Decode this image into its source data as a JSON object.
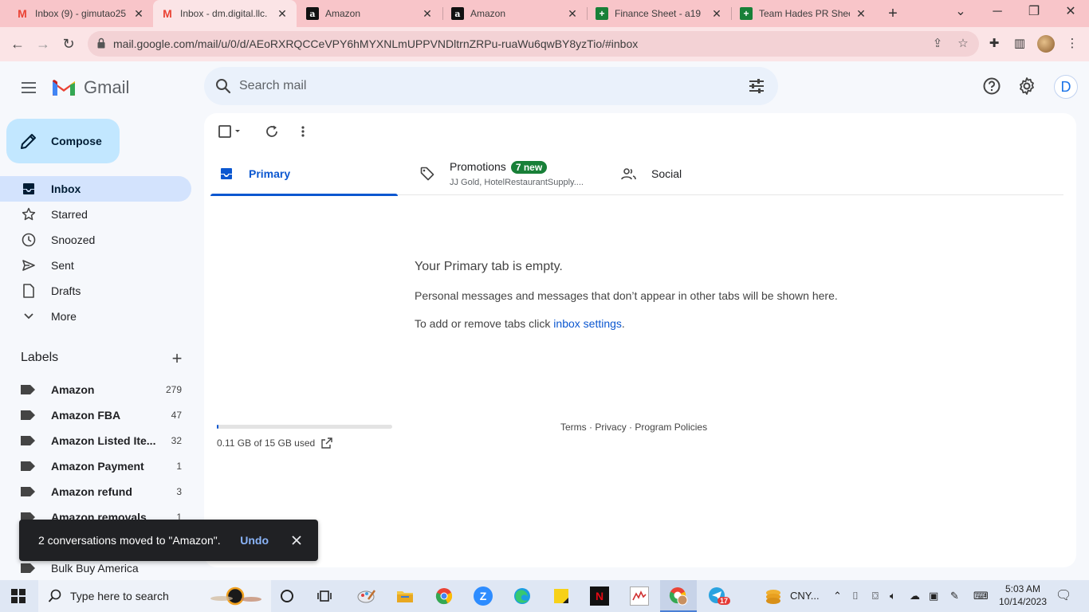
{
  "browser": {
    "tabs": [
      {
        "title": "Inbox (9) - gimutao25",
        "favicon": "gmail-icon"
      },
      {
        "title": "Inbox - dm.digital.llc.",
        "favicon": "gmail-icon",
        "active": true
      },
      {
        "title": "Amazon",
        "favicon": "amazon-icon"
      },
      {
        "title": "Amazon",
        "favicon": "amazon-icon"
      },
      {
        "title": "Finance Sheet - a19",
        "favicon": "sheets-icon"
      },
      {
        "title": "Team Hades PR Shee",
        "favicon": "sheets-icon"
      }
    ],
    "url": "mail.google.com/mail/u/0/d/AEoRXRQCCeVPY6hMYXNLmUPPVNDltrnZRPu-ruaWu6qwBY8yzTio/#inbox"
  },
  "gmail": {
    "product_name": "Gmail",
    "search_placeholder": "Search mail",
    "avatar_letter": "D",
    "compose_label": "Compose",
    "nav": [
      {
        "label": "Inbox",
        "icon": "inbox-icon",
        "active": true
      },
      {
        "label": "Starred",
        "icon": "star-icon"
      },
      {
        "label": "Snoozed",
        "icon": "clock-icon"
      },
      {
        "label": "Sent",
        "icon": "send-icon"
      },
      {
        "label": "Drafts",
        "icon": "draft-icon"
      },
      {
        "label": "More",
        "icon": "chevron-down-icon"
      }
    ],
    "labels_title": "Labels",
    "labels": [
      {
        "name": "Amazon",
        "count": "279"
      },
      {
        "name": "Amazon FBA",
        "count": "47"
      },
      {
        "name": "Amazon Listed Ite...",
        "count": "32"
      },
      {
        "name": "Amazon Payment",
        "count": "1"
      },
      {
        "name": "Amazon refund",
        "count": "3"
      },
      {
        "name": "Amazon removals",
        "count": "1"
      },
      {
        "name": "Bulk Buy America",
        "count": ""
      }
    ],
    "tabs": [
      {
        "name": "Primary",
        "icon": "inbox-tab-icon",
        "active": true
      },
      {
        "name": "Promotions",
        "icon": "tag-icon",
        "badge": "7 new",
        "subtitle": "JJ Gold, HotelRestaurantSupply...."
      },
      {
        "name": "Social",
        "icon": "people-icon"
      }
    ],
    "empty_title": "Your Primary tab is empty.",
    "empty_line1": "Personal messages and messages that don’t appear in other tabs will be shown here.",
    "empty_line2_prefix": "To add or remove tabs click ",
    "empty_line2_link": "inbox settings",
    "empty_line2_suffix": ".",
    "storage_text": "0.11 GB of 15 GB used",
    "storage_used_fraction": 0.0073,
    "footer_terms": "Terms",
    "footer_privacy": "Privacy",
    "footer_policies": "Program Policies",
    "footer_sep": "·",
    "snackbar_message": "2 conversations moved to \"Amazon\".",
    "snackbar_action": "Undo"
  },
  "taskbar": {
    "search_placeholder": "Type here to search",
    "tray_text": "CNY...",
    "chrome_badge": "17",
    "time": "5:03 AM",
    "date": "10/14/2023"
  },
  "colors": {
    "tabstrip": "#f8c5c9",
    "toolbar": "#fbe4e6",
    "compose_bg": "#c2e7ff",
    "active_nav": "#d3e3fd",
    "accent_blue": "#0b57d0",
    "badge_green": "#188038",
    "snackbar_bg": "#202124"
  }
}
